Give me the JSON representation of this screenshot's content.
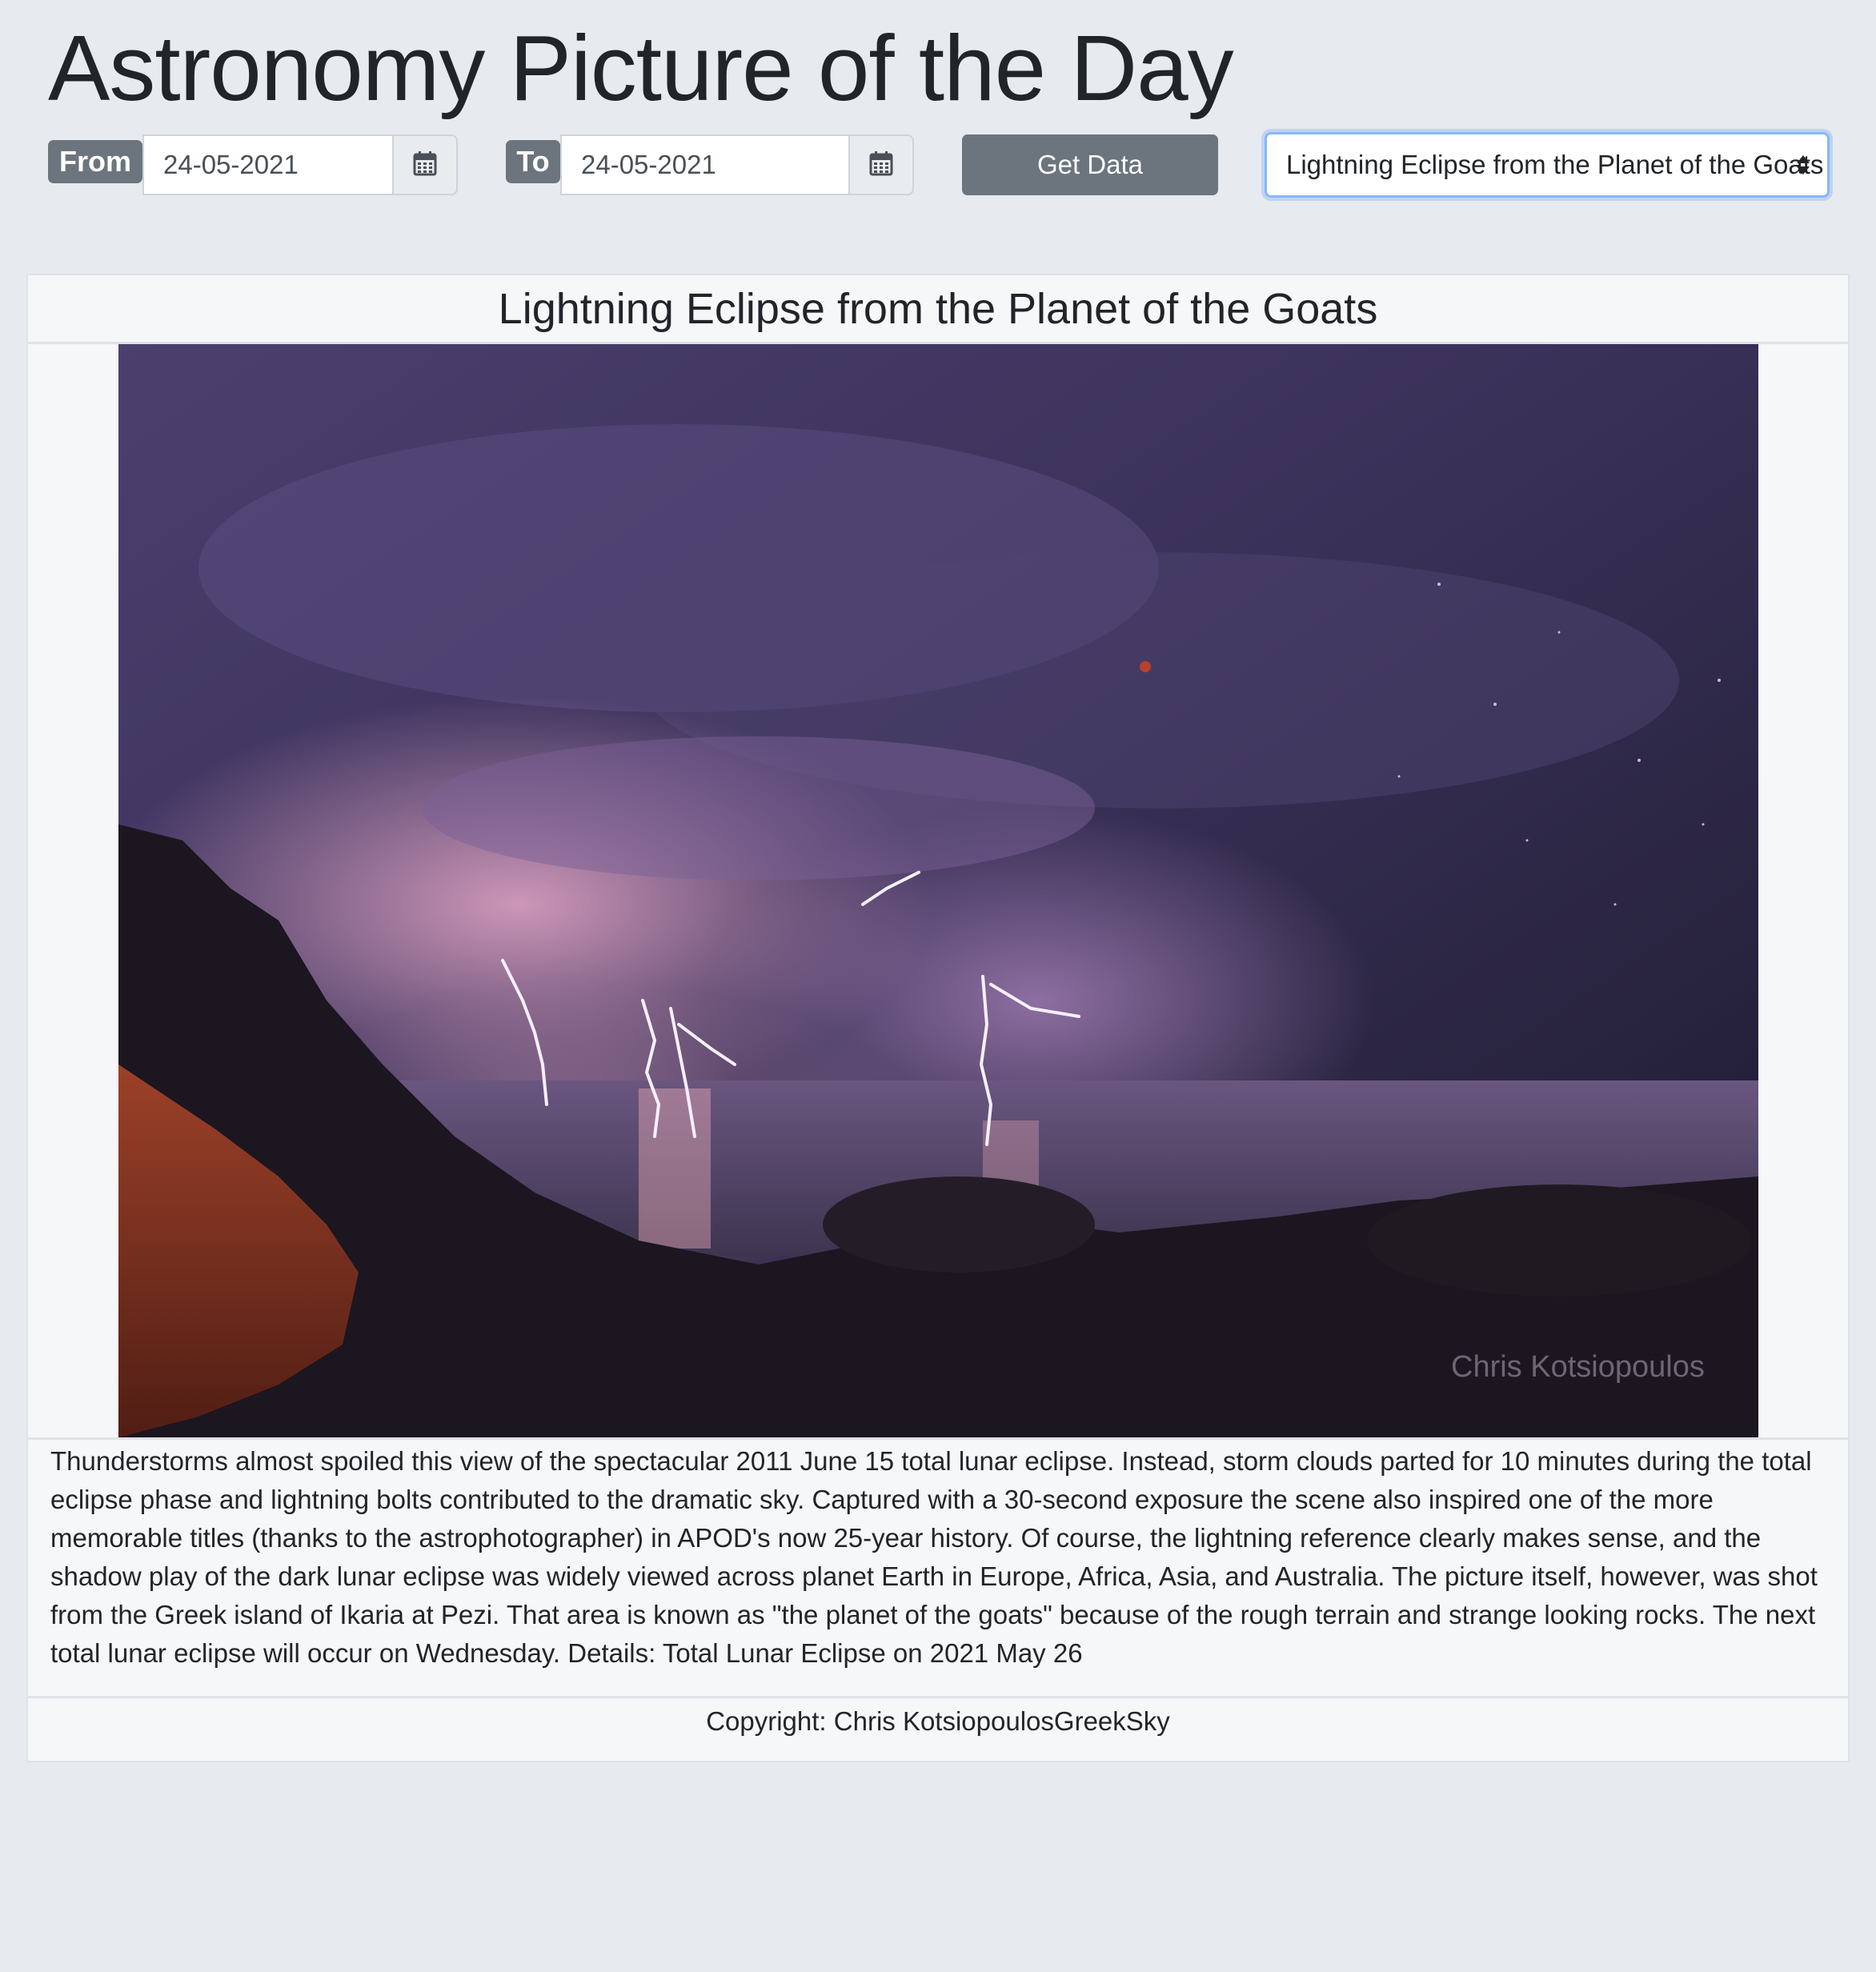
{
  "header": {
    "title": "Astronomy Picture of the Day"
  },
  "controls": {
    "from_label": "From",
    "from_date": "24-05-2021",
    "to_label": "To",
    "to_date": "24-05-2021",
    "get_data_label": "Get Data",
    "selected_title": "Lightning Eclipse from the Planet of the Goats"
  },
  "card": {
    "title": "Lightning Eclipse from the Planet of the Goats",
    "image": {
      "watermark": "Chris Kotsiopoulos"
    },
    "explanation": "Thunderstorms almost spoiled this view of the spectacular 2011 June 15 total lunar eclipse. Instead, storm clouds parted for 10 minutes during the total eclipse phase and lightning bolts contributed to the dramatic sky. Captured with a 30-second exposure the scene also inspired one of the more memorable titles (thanks to the astrophotographer) in APOD's now 25-year history. Of course, the lightning reference clearly makes sense, and the shadow play of the dark lunar eclipse was widely viewed across planet Earth in Europe, Africa, Asia, and Australia. The picture itself, however, was shot from the Greek island of Ikaria at Pezi. That area is known as \"the planet of the goats\" because of the rough terrain and strange looking rocks. The next total lunar eclipse will occur on Wednesday. Details: Total Lunar Eclipse on 2021 May 26",
    "copyright": "Copyright: Chris KotsiopoulosGreekSky"
  },
  "icons": {
    "calendar": "calendar-icon",
    "select_caret": "sort-caret-icon"
  },
  "colors": {
    "page_bg": "#e7eaef",
    "badge_bg": "#6c757d",
    "button_bg": "#6c757d",
    "select_focus": "#86b7fe"
  }
}
